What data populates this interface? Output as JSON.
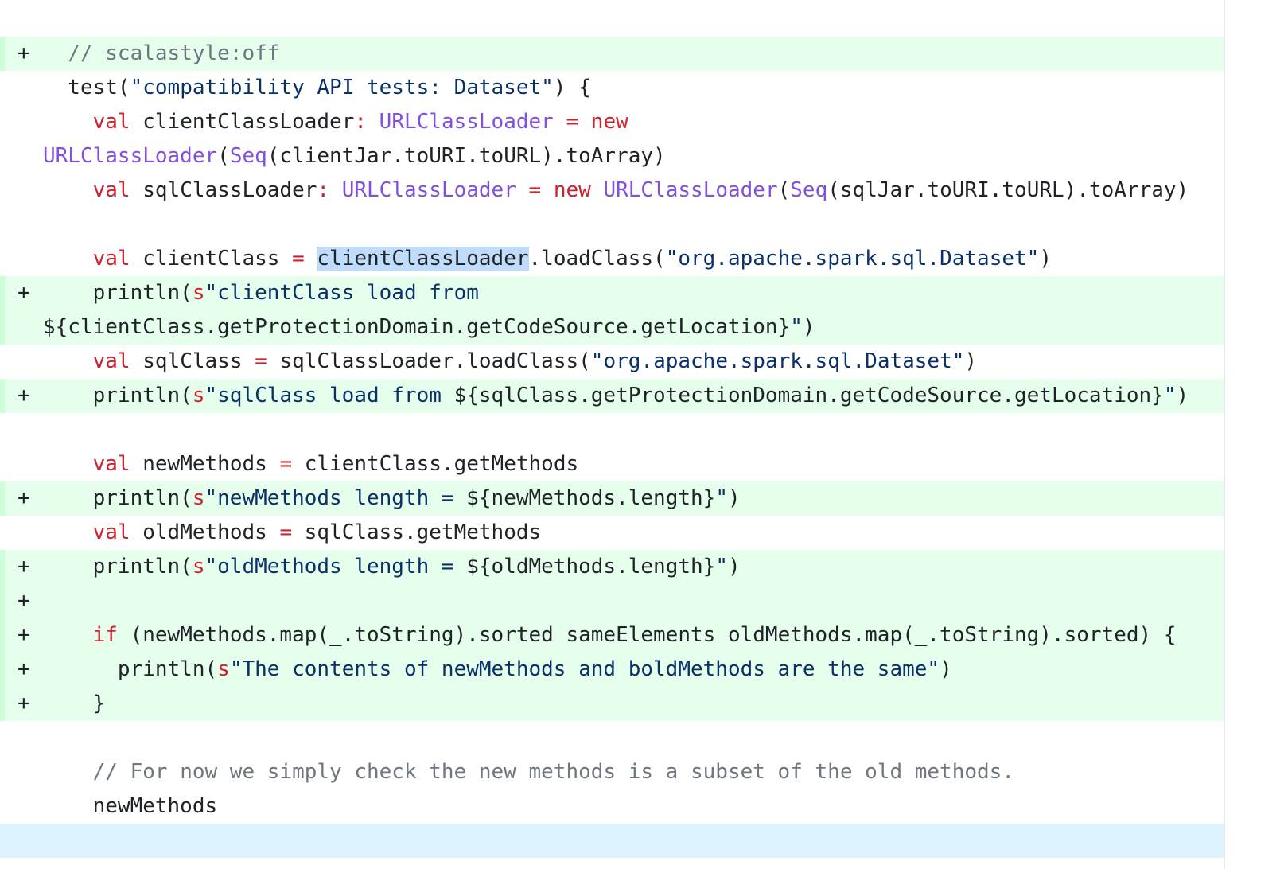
{
  "diff": {
    "lines": [
      {
        "marker": "+",
        "added": true,
        "tokens": [
          {
            "t": "  "
          },
          {
            "t": "// scalastyle:off",
            "c": "com"
          }
        ]
      },
      {
        "marker": "",
        "added": false,
        "tokens": [
          {
            "t": "  test("
          },
          {
            "t": "\"compatibility API tests: Dataset\"",
            "c": "str"
          },
          {
            "t": ") {"
          }
        ]
      },
      {
        "marker": "",
        "added": false,
        "tokens": [
          {
            "t": "    "
          },
          {
            "t": "val",
            "c": "kw"
          },
          {
            "t": " clientClassLoader"
          },
          {
            "t": ":",
            "c": "kw"
          },
          {
            "t": " "
          },
          {
            "t": "URLClassLoader",
            "c": "ty"
          },
          {
            "t": " "
          },
          {
            "t": "=",
            "c": "kw"
          },
          {
            "t": " "
          },
          {
            "t": "new",
            "c": "kw"
          }
        ]
      },
      {
        "marker": "",
        "added": false,
        "tokens": [
          {
            "t": "URLClassLoader",
            "c": "ty"
          },
          {
            "t": "("
          },
          {
            "t": "Seq",
            "c": "ty"
          },
          {
            "t": "(clientJar.toURI.toURL).toArray)"
          }
        ]
      },
      {
        "marker": "",
        "added": false,
        "tokens": [
          {
            "t": "    "
          },
          {
            "t": "val",
            "c": "kw"
          },
          {
            "t": " sqlClassLoader"
          },
          {
            "t": ":",
            "c": "kw"
          },
          {
            "t": " "
          },
          {
            "t": "URLClassLoader",
            "c": "ty"
          },
          {
            "t": " "
          },
          {
            "t": "=",
            "c": "kw"
          },
          {
            "t": " "
          },
          {
            "t": "new",
            "c": "kw"
          },
          {
            "t": " "
          },
          {
            "t": "URLClassLoader",
            "c": "ty"
          },
          {
            "t": "("
          },
          {
            "t": "Seq",
            "c": "ty"
          },
          {
            "t": "(sqlJar.toURI.toURL).toArray)"
          }
        ]
      },
      {
        "marker": "",
        "added": false,
        "tokens": [
          {
            "t": ""
          }
        ]
      },
      {
        "marker": "",
        "added": false,
        "tokens": [
          {
            "t": "    "
          },
          {
            "t": "val",
            "c": "kw"
          },
          {
            "t": " clientClass "
          },
          {
            "t": "=",
            "c": "kw"
          },
          {
            "t": " "
          },
          {
            "t": "clientClassLoader",
            "c": "hl"
          },
          {
            "t": ".loadClass("
          },
          {
            "t": "\"org.apache.spark.sql.Dataset\"",
            "c": "str"
          },
          {
            "t": ")"
          }
        ]
      },
      {
        "marker": "+",
        "added": true,
        "tokens": [
          {
            "t": "    println("
          },
          {
            "t": "s",
            "c": "kw"
          },
          {
            "t": "\"clientClass load from",
            "c": "str"
          }
        ]
      },
      {
        "marker": "",
        "added": true,
        "tokens": [
          {
            "t": "${clientClass.getProtectionDomain.getCodeSource.getLocation}"
          },
          {
            "t": "\"",
            "c": "str"
          },
          {
            "t": ")"
          }
        ]
      },
      {
        "marker": "",
        "added": false,
        "tokens": [
          {
            "t": "    "
          },
          {
            "t": "val",
            "c": "kw"
          },
          {
            "t": " sqlClass "
          },
          {
            "t": "=",
            "c": "kw"
          },
          {
            "t": " sqlClassLoader.loadClass("
          },
          {
            "t": "\"org.apache.spark.sql.Dataset\"",
            "c": "str"
          },
          {
            "t": ")"
          }
        ]
      },
      {
        "marker": "+",
        "added": true,
        "tokens": [
          {
            "t": "    println("
          },
          {
            "t": "s",
            "c": "kw"
          },
          {
            "t": "\"sqlClass load from ",
            "c": "str"
          },
          {
            "t": "${sqlClass.getProtectionDomain.getCodeSource.getLocation}"
          },
          {
            "t": "\"",
            "c": "str"
          },
          {
            "t": ")"
          }
        ]
      },
      {
        "marker": "",
        "added": false,
        "tokens": [
          {
            "t": ""
          }
        ]
      },
      {
        "marker": "",
        "added": false,
        "tokens": [
          {
            "t": "    "
          },
          {
            "t": "val",
            "c": "kw"
          },
          {
            "t": " newMethods "
          },
          {
            "t": "=",
            "c": "kw"
          },
          {
            "t": " clientClass.getMethods"
          }
        ]
      },
      {
        "marker": "+",
        "added": true,
        "tokens": [
          {
            "t": "    println("
          },
          {
            "t": "s",
            "c": "kw"
          },
          {
            "t": "\"newMethods length = ",
            "c": "str"
          },
          {
            "t": "${newMethods.length}"
          },
          {
            "t": "\"",
            "c": "str"
          },
          {
            "t": ")"
          }
        ]
      },
      {
        "marker": "",
        "added": false,
        "tokens": [
          {
            "t": "    "
          },
          {
            "t": "val",
            "c": "kw"
          },
          {
            "t": " oldMethods "
          },
          {
            "t": "=",
            "c": "kw"
          },
          {
            "t": " sqlClass.getMethods"
          }
        ]
      },
      {
        "marker": "+",
        "added": true,
        "tokens": [
          {
            "t": "    println("
          },
          {
            "t": "s",
            "c": "kw"
          },
          {
            "t": "\"oldMethods length = ",
            "c": "str"
          },
          {
            "t": "${oldMethods.length}"
          },
          {
            "t": "\"",
            "c": "str"
          },
          {
            "t": ")"
          }
        ]
      },
      {
        "marker": "+",
        "added": true,
        "tokens": [
          {
            "t": ""
          }
        ]
      },
      {
        "marker": "+",
        "added": true,
        "tokens": [
          {
            "t": "    "
          },
          {
            "t": "if",
            "c": "kw"
          },
          {
            "t": " (newMethods.map(_.toString).sorted sameElements oldMethods.map(_.toString).sorted) {"
          }
        ]
      },
      {
        "marker": "+",
        "added": true,
        "tokens": [
          {
            "t": "      println("
          },
          {
            "t": "s",
            "c": "kw"
          },
          {
            "t": "\"The contents of newMethods and boldMethods are the same\"",
            "c": "str"
          },
          {
            "t": ")"
          }
        ]
      },
      {
        "marker": "+",
        "added": true,
        "tokens": [
          {
            "t": "    }"
          }
        ]
      },
      {
        "marker": "",
        "added": false,
        "tokens": [
          {
            "t": ""
          }
        ]
      },
      {
        "marker": "",
        "added": false,
        "tokens": [
          {
            "t": "    "
          },
          {
            "t": "// For now we simply check the new methods is a subset of the old methods.",
            "c": "com"
          }
        ]
      },
      {
        "marker": "",
        "added": false,
        "tokens": [
          {
            "t": "    newMethods"
          }
        ]
      }
    ]
  }
}
